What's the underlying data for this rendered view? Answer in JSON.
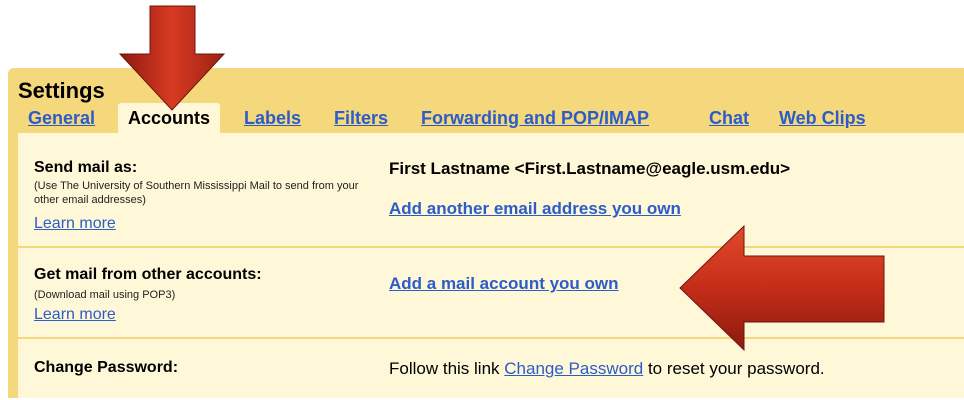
{
  "settings": {
    "title": "Settings",
    "tabs": [
      {
        "label": "General",
        "active": false
      },
      {
        "label": "Accounts",
        "active": true
      },
      {
        "label": "Labels",
        "active": false
      },
      {
        "label": "Filters",
        "active": false
      },
      {
        "label": "Forwarding and POP/IMAP",
        "active": false
      },
      {
        "label": "Chat",
        "active": false
      },
      {
        "label": "Web Clips",
        "active": false
      }
    ]
  },
  "rows": {
    "send_mail": {
      "label": "Send mail as:",
      "note": "(Use The University of Southern Mississippi Mail to send from your other email addresses)",
      "learn_more": "Learn more",
      "address": "First Lastname <First.Lastname@eagle.usm.edu>",
      "add_link": "Add another email address you own"
    },
    "get_mail": {
      "label": "Get mail from other accounts:",
      "note": "(Download mail using POP3)",
      "learn_more": "Learn more",
      "add_link": "Add a mail account you own"
    },
    "change_password": {
      "label": "Change Password:",
      "text_before": "Follow this link",
      "link": "Change Password",
      "text_after": "to reset your password."
    }
  },
  "colors": {
    "header_bg": "#f6d87c",
    "content_bg": "#fef7d8",
    "link": "#2b5cc8",
    "arrow": "#c8321e"
  },
  "annotations": {
    "arrow_down_icon": "arrow-down pointing at Accounts tab",
    "arrow_left_icon": "arrow-left pointing at Add a mail account link"
  }
}
